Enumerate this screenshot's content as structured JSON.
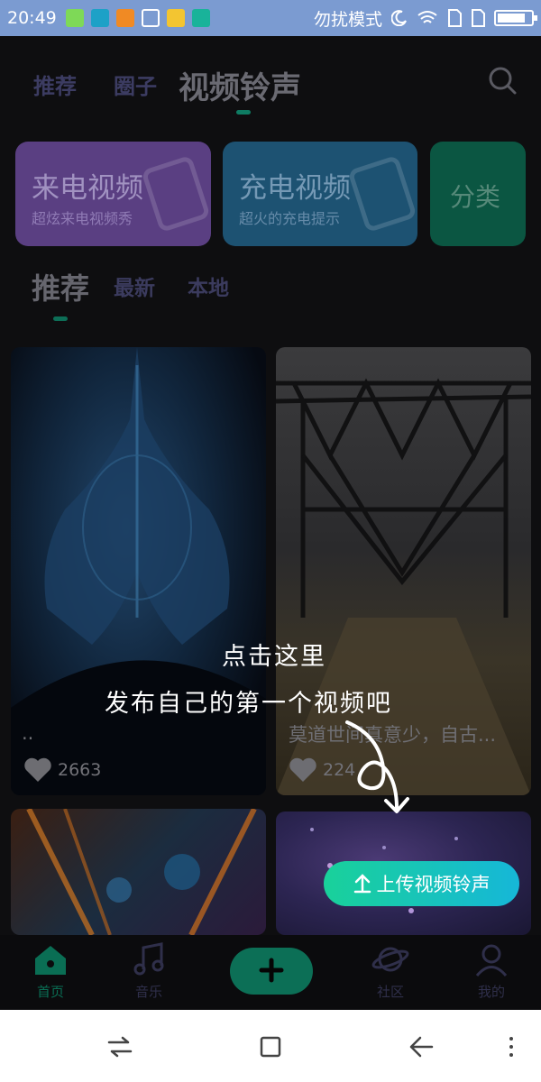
{
  "status_bar": {
    "time": "20:49",
    "dnd_label": "勿扰模式",
    "battery_level": 0.85
  },
  "top_tabs": [
    {
      "label": "推荐"
    },
    {
      "label": "圈子"
    },
    {
      "label": "视频铃声"
    }
  ],
  "categories": [
    {
      "title": "来电视频",
      "subtitle": "超炫来电视频秀",
      "color": "#6b4c96"
    },
    {
      "title": "充电视频",
      "subtitle": "超火的充电提示",
      "color": "#1f5b7f"
    },
    {
      "title": "分类",
      "subtitle": "",
      "color": "#0d5f49"
    }
  ],
  "sub_tabs": [
    {
      "label": "推荐"
    },
    {
      "label": "最新"
    },
    {
      "label": "本地"
    }
  ],
  "videos": [
    {
      "caption": "..",
      "likes": "2663"
    },
    {
      "caption": "莫道世间真意少，自古...",
      "likes": "224"
    },
    {
      "caption": "",
      "likes": ""
    },
    {
      "caption": "",
      "likes": ""
    }
  ],
  "guide": {
    "line1": "点击这里",
    "line2": "发布自己的第一个视频吧",
    "upload_label": "上传视频铃声"
  },
  "bottom_nav": [
    {
      "label": "首页",
      "icon": "home-icon"
    },
    {
      "label": "音乐",
      "icon": "music-icon"
    },
    {
      "label": "",
      "icon": "add-icon"
    },
    {
      "label": "社区",
      "icon": "planet-icon"
    },
    {
      "label": "我的",
      "icon": "profile-icon"
    }
  ],
  "colors": {
    "accent": "#19d19a",
    "status_bar": "#7b9bd1"
  }
}
